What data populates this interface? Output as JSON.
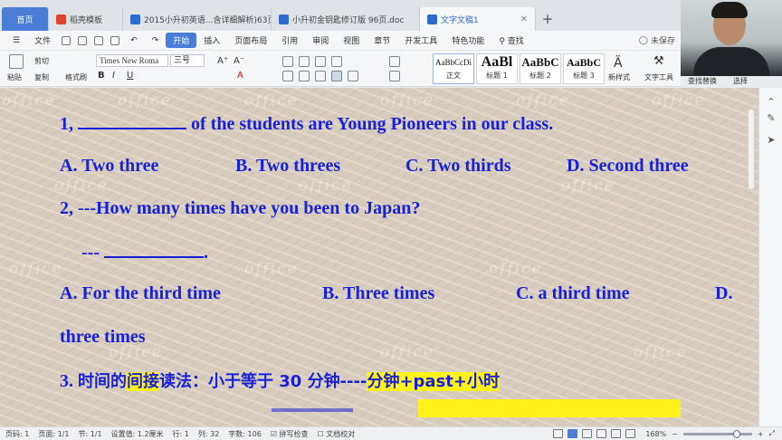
{
  "tabs": [
    {
      "label": "首页",
      "kind": "home"
    },
    {
      "label": "稻壳模板",
      "kind": "doc",
      "icon_color": "#e0442f"
    },
    {
      "label": "2015小升初英语...含详细解析)63页",
      "kind": "doc",
      "icon_color": "#2e6bd1"
    },
    {
      "label": "小升初金钥匙修订版 96页.doc",
      "kind": "doc",
      "icon_color": "#2e6bd1"
    },
    {
      "label": "文字文稿1",
      "kind": "active",
      "icon_color": "#2e6bd1"
    }
  ],
  "menu": {
    "file": "文件",
    "items": [
      "开始",
      "插入",
      "页面布局",
      "引用",
      "审阅",
      "视图",
      "章节",
      "开发工具",
      "特色功能"
    ],
    "active": "开始",
    "search": "查找",
    "unsaved": "未保存"
  },
  "ribbon": {
    "paste": "粘贴",
    "cut": "剪切",
    "copy": "复制",
    "format_painter": "格式刷",
    "font_name": "Times New Roma",
    "font_size": "三号",
    "styles": [
      {
        "preview": "AaBbCcDi",
        "label": "正文"
      },
      {
        "preview": "AaBl",
        "label": "标题 1"
      },
      {
        "preview": "AaBbC",
        "label": "标题 2"
      },
      {
        "preview": "AaBbC",
        "label": "标题 3"
      }
    ],
    "new_style": "新样式",
    "text_tools": "文字工具",
    "find_replace": "查找替换",
    "select": "选择"
  },
  "document": {
    "q1_num": "1,",
    "q1_text": "of the students are Young Pioneers in our class.",
    "q1_options": [
      "A. Two three",
      "B. Two threes",
      "C. Two thirds",
      "D. Second three"
    ],
    "q2_question": "2, ---How many times have you been to Japan?",
    "q2_reply_prefix": "---",
    "q2_options": [
      "A.  For the third time",
      "B. Three times",
      "C. a third time",
      "D."
    ],
    "q2_option_d_cont": "three times",
    "section3_num": "3.",
    "section3_pre": "时间的",
    "section3_hl": "间接",
    "section3_mid": "读法：小于等于 30 分钟----",
    "section3_rule": "分钟+past+小时",
    "watermark": "office"
  },
  "statusbar": {
    "page": "页码: 1",
    "pages": "页面: 1/1",
    "section": "节: 1/1",
    "setting": "设置值: 1.2厘米",
    "row": "行: 1",
    "col": "列: 32",
    "words": "字数: 106",
    "spell": "拼写检查",
    "proof": "文档校对",
    "zoom": "168%",
    "zoom_level": 0.72
  }
}
